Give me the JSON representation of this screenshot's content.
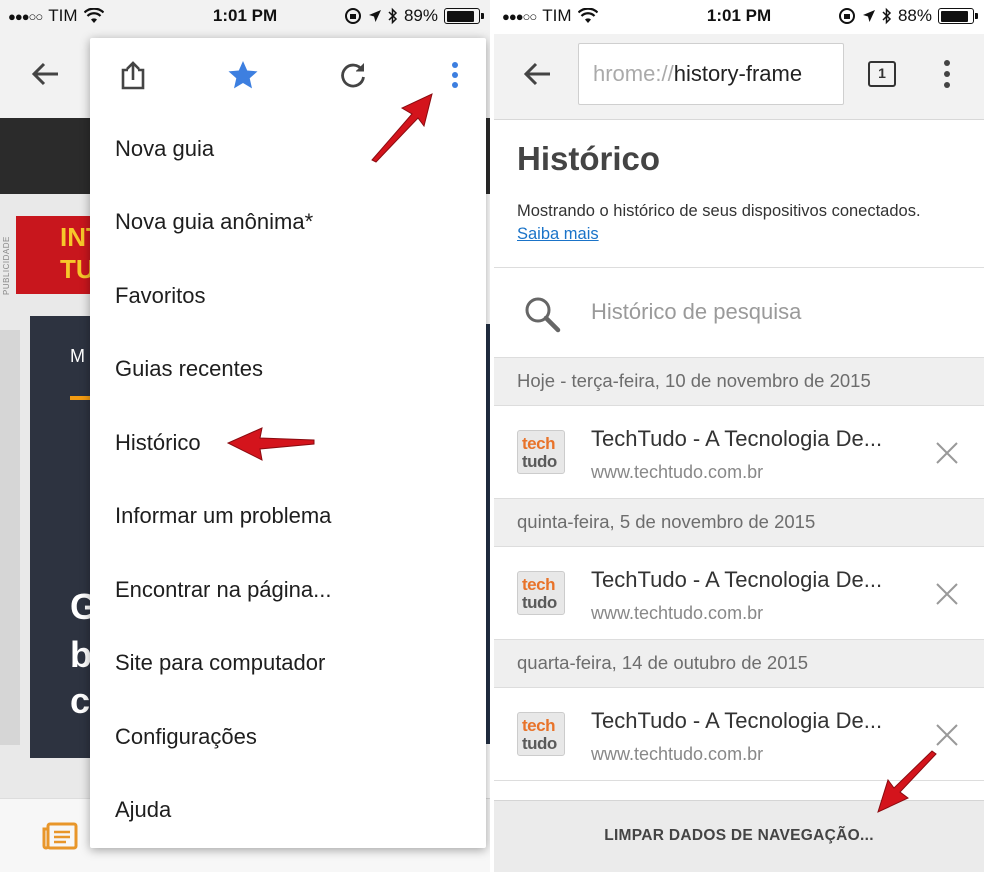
{
  "status_left": {
    "carrier": "TIM",
    "time": "1:01 PM",
    "battery": "89%",
    "battery_level": 0.89
  },
  "status_right": {
    "carrier": "TIM",
    "time": "1:01 PM",
    "battery": "88%",
    "battery_level": 0.88
  },
  "left_page": {
    "side_label": "PUBLICIDADE",
    "ad_line1": "INT",
    "ad_line2": "TU",
    "hero_top": "M",
    "hero_letters": [
      "G",
      "b",
      "c"
    ]
  },
  "menu": {
    "items": [
      "Nova guia",
      "Nova guia anônima*",
      "Favoritos",
      "Guias recentes",
      "Histórico",
      "Informar um problema",
      "Encontrar na página...",
      "Site para computador",
      "Configurações",
      "Ajuda"
    ]
  },
  "right": {
    "omnibox_faded": "hrome://",
    "omnibox_text": "history-frame",
    "tab_count": "1",
    "title": "Histórico",
    "description": "Mostrando o histórico de seus dispositivos conectados.",
    "learn_more": "Saiba mais",
    "search_placeholder": "Histórico de pesquisa",
    "groups": [
      {
        "date": "Hoje - terça-feira, 10 de novembro de 2015",
        "title": "TechTudo - A Tecnologia De...",
        "url": "www.techtudo.com.br"
      },
      {
        "date": "quinta-feira, 5 de novembro de 2015",
        "title": "TechTudo - A Tecnologia De...",
        "url": "www.techtudo.com.br"
      },
      {
        "date": "quarta-feira, 14 de outubro de 2015",
        "title": "TechTudo - A Tecnologia De...",
        "url": "www.techtudo.com.br"
      }
    ],
    "favicon_line1": "tech",
    "favicon_line2": "tudo",
    "clear_button": "LIMPAR DADOS DE NAVEGAÇÃO..."
  },
  "colors": {
    "accent_blue": "#3d7fe0",
    "arrow_red": "#d4141c",
    "link_blue": "#1a73c8"
  }
}
